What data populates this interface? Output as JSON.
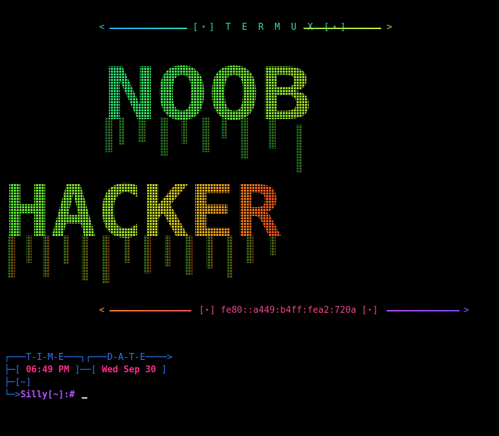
{
  "header": {
    "left_arrow": "<",
    "title": "[⋆] T E R M U X [⋆]",
    "right_arrow": ">"
  },
  "banner": {
    "line1": "NOOB",
    "line2": "HACKER",
    "colors": [
      "#1ee07a",
      "#55ee33",
      "#8ee62a",
      "#c7d61a",
      "#e4a512",
      "#ef6a1c",
      "#ff4a1c"
    ]
  },
  "ip_line": {
    "left_arrow": "<",
    "address": "[⋆] fe80::a449:b4ff:fea2:720a [⋆]",
    "right_arrow": ">"
  },
  "prompt": {
    "time_label": "T-I-M-E",
    "date_label": "D-A-T-E",
    "time": "06:49 PM",
    "date": "Wed Sep 30",
    "cwd": "~",
    "user": "Silly",
    "user_dir": "~",
    "symbol": "#"
  }
}
